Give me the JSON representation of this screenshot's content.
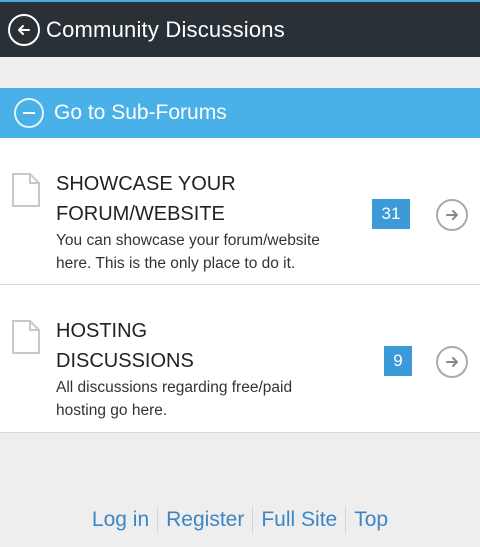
{
  "header": {
    "title": "Community Discussions",
    "back_icon": "back-arrow-icon"
  },
  "subforum_bar": {
    "label": "Go to Sub-Forums",
    "icon": "collapse-minus-icon"
  },
  "forums": [
    {
      "title_line1": "SHOWCASE YOUR",
      "title_line2": "FORUM/WEBSITE",
      "description_line1": "You can showcase your forum/website",
      "description_line2": "here. This is the only place to do it.",
      "count": "31"
    },
    {
      "title_line1": "HOSTING",
      "title_line2": "DISCUSSIONS",
      "description_line1": "All discussions regarding free/paid",
      "description_line2": "hosting go here.",
      "count": "9"
    }
  ],
  "footer": {
    "links": [
      "Log in",
      "Register",
      "Full Site",
      "Top"
    ]
  },
  "colors": {
    "header_bg": "#2a3136",
    "accent": "#4ab0e8",
    "badge": "#3d9ad8",
    "link": "#3d86c6"
  }
}
